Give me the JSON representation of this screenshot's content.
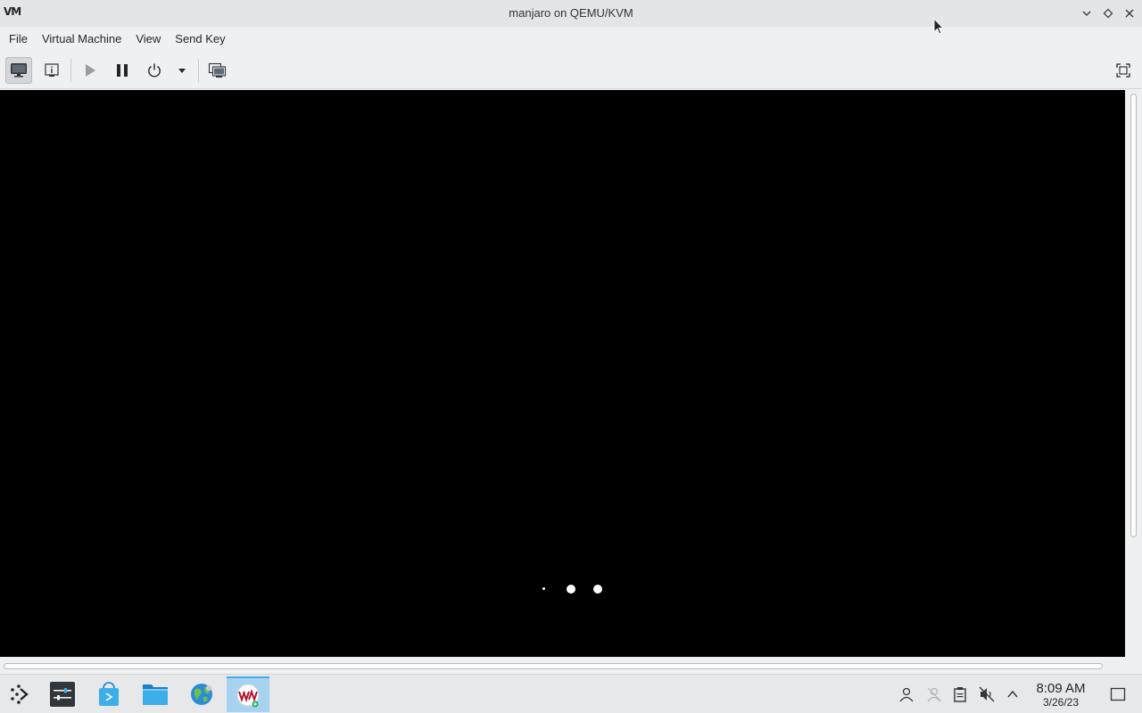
{
  "window": {
    "app_icon_text": "VM",
    "title": "manjaro on QEMU/KVM"
  },
  "menu": {
    "items": [
      "File",
      "Virtual Machine",
      "View",
      "Send Key"
    ]
  },
  "toolbar": {
    "buttons": [
      "console-view",
      "details-view",
      "run",
      "pause",
      "shutdown",
      "shutdown-menu",
      "snapshots",
      "fullscreen"
    ]
  },
  "taskbar": {
    "clock_time": "8:09 AM",
    "clock_date": "3/26/23"
  },
  "colors": {
    "accent": "#3daee9",
    "console_bg": "#000000"
  }
}
